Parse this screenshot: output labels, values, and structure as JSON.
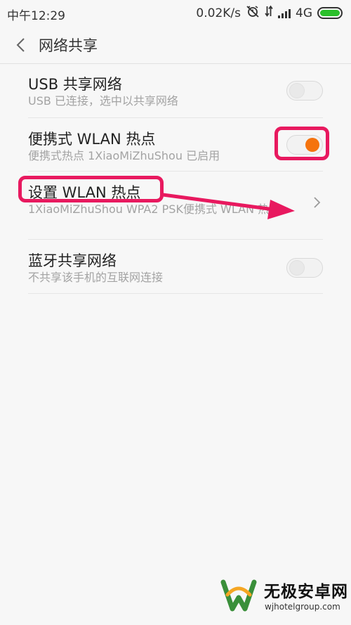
{
  "status_bar": {
    "time": "中午12:29",
    "speed": "0.02K/s",
    "network_type": "4G",
    "icons": [
      "alarm-off-icon",
      "data-transfer-icon",
      "signal-icon",
      "battery-icon"
    ],
    "battery_level": 1.0,
    "battery_color": "#2bc02b"
  },
  "header": {
    "title": "网络共享",
    "back_icon": "chevron-left-icon"
  },
  "settings": {
    "usb": {
      "title": "USB 共享网络",
      "subtitle": "USB 已连接，选中以共享网络",
      "enabled": false
    },
    "hotspot": {
      "title": "便携式 WLAN 热点",
      "subtitle": "便携式热点 1XiaoMiZhuShou 已启用",
      "enabled": true,
      "accent": "#f5730e"
    },
    "config": {
      "title": "设置 WLAN 热点",
      "subtitle": "1XiaoMiZhuShou WPA2 PSK便携式 WLAN 热点",
      "icon": "chevron-right-icon"
    },
    "bluetooth": {
      "title": "蓝牙共享网络",
      "subtitle": "不共享该手机的互联网连接",
      "enabled": false
    }
  },
  "annotation": {
    "highlight_color": "#e8195f"
  },
  "watermark": {
    "name": "无极安卓网",
    "url": "wjhotelgroup.com",
    "logo_colors": [
      "#3a8f3a",
      "#f5a623"
    ]
  }
}
